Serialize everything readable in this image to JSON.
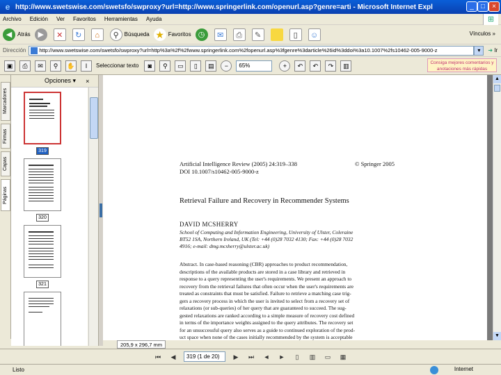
{
  "window": {
    "title": "http://www.swetswise.com/swetsfo/swproxy?url=http://www.springerlink.com/openurl.asp?genre=arti - Microsoft Internet Explorer",
    "min": "_",
    "max": "□",
    "close": "×"
  },
  "menu": [
    "Archivo",
    "Edición",
    "Ver",
    "Favoritos",
    "Herramientas",
    "Ayuda"
  ],
  "toolbar": {
    "back": "Atrás",
    "search": "Búsqueda",
    "favorites": "Favoritos",
    "links": "Vínculos",
    "chevron": "»"
  },
  "address": {
    "label": "Dirección",
    "value": "http://www.swetswise.com/swetsfo/swproxy?url=http%3a%2f%2fwww.springerlink.com%2fopenurl.asp%3fgenre%3darticle%26id%3ddoi%3a10.1007%2fs10462-005-9000-z",
    "go": "Ir"
  },
  "acrobat": {
    "select_text": "Seleccionar texto",
    "zoom": "65%",
    "promo": "Consiga mejores comentarios y anotaciones más rápidas"
  },
  "sidetabs": [
    "Marcadores",
    "Firmas",
    "Capas",
    "Páginas"
  ],
  "thumbs": {
    "header": "Opciones",
    "close": "×",
    "pages": [
      {
        "label": "319",
        "selected": true
      },
      {
        "label": "320",
        "selected": false
      },
      {
        "label": "321",
        "selected": false
      }
    ]
  },
  "paper": {
    "journal": "Artificial Intelligence Review (2005) 24:319–338",
    "copyright": "© Springer 2005",
    "doi": "DOI 10.1007/s10462-005-9000-z",
    "title": "Retrieval Failure and Recovery in Recommender Systems",
    "author": "DAVID MCSHERRY",
    "affil_1": "School of Computing and Information Engineering, University of Ulster, Coleraine",
    "affil_2": "BT52 1SA, Northern Ireland, UK (Tel: +44 (0)28 7032 4130; Fax: +44 (0)28 7032",
    "affil_3": "4916; e-mail: dmg.mcsherry@ulster.ac.uk)",
    "abstract": [
      "Abstract. In case-based reasoning (CBR) approaches to product recommendation,",
      "descriptions of the available products are stored in a case library and retrieved in",
      "response to a query representing the user's requirements. We present an approach to",
      "recovery from the retrieval failures that often occur when the user's requirements are",
      "treated as constraints that must be satisfied. Failure to retrieve a matching case trig-",
      "gers a recovery process in which the user is invited to select from a recovery set of",
      "relaxations (or sub-queries) of her query that are guaranteed to succeed. The sug-",
      "gested relaxations are ranked according to a simple measure of recovery cost defined",
      "in terms of the importance weights assigned to the query attributes. The recovery set",
      "for an unsuccessful query also serves as a guide to continued exploration of the prod-",
      "uct space when none of the cases initially recommended by the system is acceptable"
    ]
  },
  "size_readout": "205,9 x 296,7 mm",
  "nav": {
    "page": "319 (1 de 20)"
  },
  "status": {
    "text": "Listo",
    "zone": "Internet"
  }
}
